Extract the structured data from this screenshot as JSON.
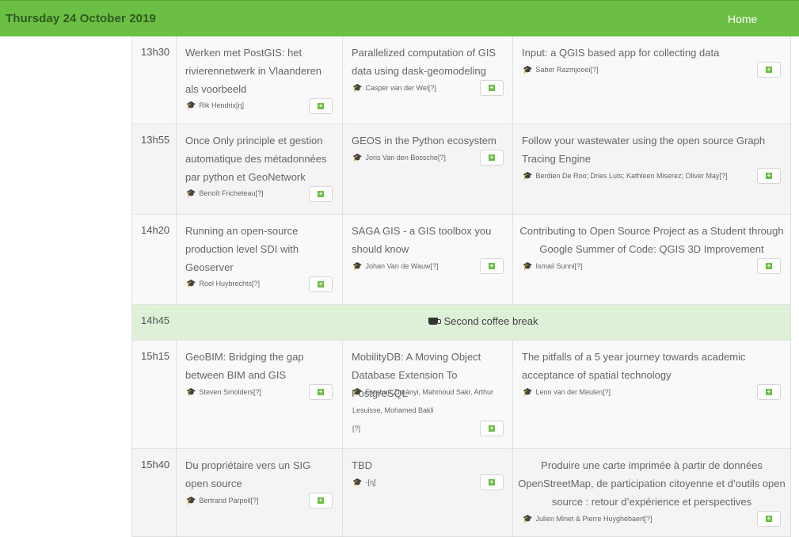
{
  "header": {
    "date": "Thursday 24 October 2019",
    "home_label": "Home"
  },
  "rows": [
    {
      "time": "13h30",
      "talks": [
        {
          "title": "Werken met PostGIS: het rivierennetwerk in Vlaanderen als voorbeeld",
          "speaker": "Rik Hendrix[ɳ]"
        },
        {
          "title": "Parallelized computation of GIS data using dask-geomodeling",
          "speaker": "Casper van der Wel[?]"
        },
        {
          "title": "Input: a QGIS based app for collecting data",
          "speaker": "Saber Razmjooei[?]"
        }
      ]
    },
    {
      "time": "13h55",
      "talks": [
        {
          "title": "Once Only principle et gestion automatique des métadonnées par python et GeoNetwork",
          "speaker": "Benoît Fricheteau[?]"
        },
        {
          "title": "GEOS in the Python ecosystem",
          "speaker": "Joris Van den Bossche[?]"
        },
        {
          "title": "Follow your wastewater using the open source Graph Tracing Engine",
          "speaker": "Berdien De Roo; Dries Luts; Kathleen Miserez; Oliver May[?]"
        }
      ]
    },
    {
      "time": "14h20",
      "talks": [
        {
          "title": "Running an open-source production level SDI with Geoserver",
          "speaker": "Roel Huybrechts[?]"
        },
        {
          "title": "SAGA GIS - a GIS toolbox you should know",
          "speaker": "Johan Van de Wauw[?]"
        },
        {
          "title": "Contributing to Open Source Project as a Student through Google Summer of Code: QGIS 3D Improvement",
          "speaker": "Ismail Sunni[?]"
        }
      ]
    },
    {
      "time": "14h45",
      "break_label": "Second coffee break"
    },
    {
      "time": "15h15",
      "talks": [
        {
          "title": "GeoBIM: Bridging the gap between BIM and GIS",
          "speaker": "Steven Smolders[?]"
        },
        {
          "title": "MobilityDB: A Moving Object Database Extension To PostgreSQL",
          "speaker_line1": "Esteban Zimányi, Mahmoud Sakr, Arthur",
          "speaker_line2": "Lesuisse, Mohamed Bakli",
          "speaker_line3": "[?]"
        },
        {
          "title": "The pitfalls of a 5 year journey towards academic acceptance of spatial technology",
          "speaker": "Leon van der Meulen[?]"
        }
      ]
    },
    {
      "time": "15h40",
      "talks": [
        {
          "title": "Du propriétaire vers un SIG open source",
          "speaker": "Bertrand Parpoil[?]"
        },
        {
          "title": "TBD",
          "speaker": "-[ɳ]"
        },
        {
          "title": "Produire une carte imprimée à partir de données OpenStreetMap, de participation citoyenne et d’outils open source : retour d’expérience et perspectives",
          "speaker": "Julien Minet & Pierre Huyghebaert[?]"
        }
      ]
    }
  ],
  "icons": {
    "speaker": "graduation-cap-icon",
    "add": "plus-square-icon",
    "break": "coffee-cup-icon"
  },
  "colors": {
    "header_bg": "#6cbf45",
    "date_text": "#2f5a1f",
    "break_bg": "#dff0d8",
    "accent": "#6cbf45"
  }
}
